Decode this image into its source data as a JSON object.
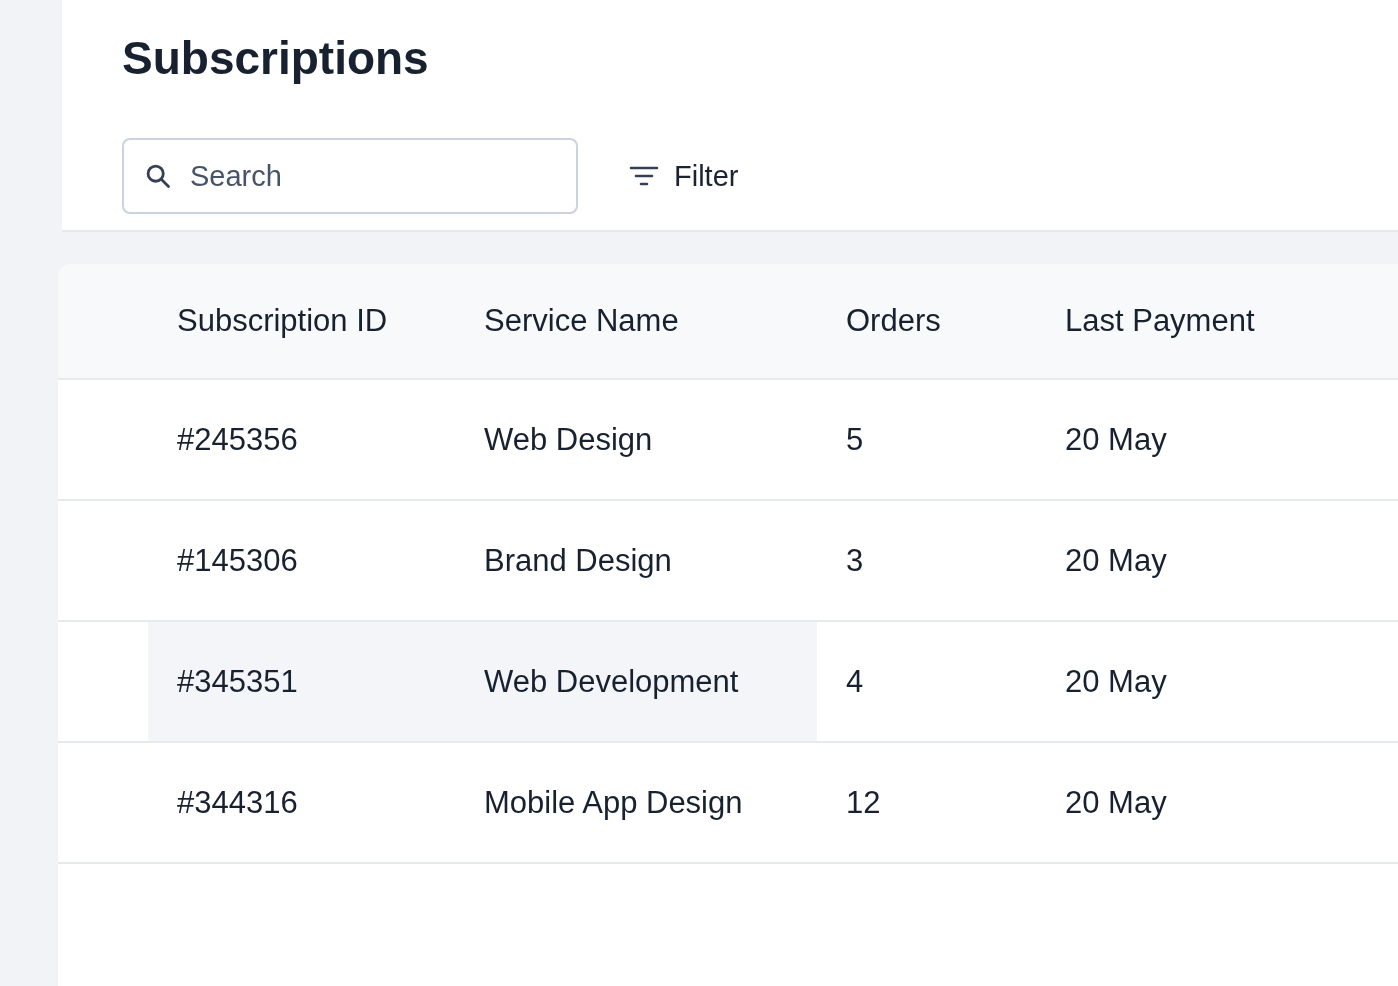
{
  "title": "Subscriptions",
  "search": {
    "placeholder": "Search"
  },
  "filter": {
    "label": "Filter"
  },
  "table": {
    "columns": [
      "Subscription ID",
      "Service Name",
      "Orders",
      "Last Payment"
    ],
    "rows": [
      {
        "cells": [
          "#245356",
          "Web Design",
          "5",
          "20 May"
        ],
        "highlighted": false
      },
      {
        "cells": [
          "#145306",
          "Brand Design",
          "3",
          "20 May"
        ],
        "highlighted": false
      },
      {
        "cells": [
          "#345351",
          "Web Development",
          "4",
          "20 May"
        ],
        "highlighted": true
      },
      {
        "cells": [
          "#344316",
          "Mobile App Design",
          "12",
          "20 May"
        ],
        "highlighted": false
      }
    ]
  }
}
